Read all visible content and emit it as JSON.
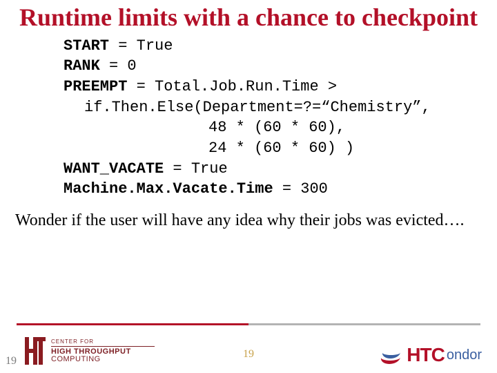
{
  "title": "Runtime limits with a chance to checkpoint",
  "config": {
    "start_k": "START",
    "start_v": " = True",
    "rank_k": "RANK",
    "rank_v": " = 0",
    "preempt_k": "PREEMPT",
    "preempt_v": " = Total.Job.Run.Time >",
    "ifthen": "if.Then.Else(Department=?=“Chemistry”,",
    "line48": "48 * (60 * 60),",
    "line24": "24 * (60 * 60) )",
    "wv_k": "WANT_VACATE",
    "wv_v": " = True",
    "mmvt_k": "Machine.Max.Vacate.Time",
    "mmvt_v": " = 300"
  },
  "remark": "Wonder if the user will have any idea why their jobs was evicted….",
  "page_center": "19",
  "page_left": "19",
  "logo_left": {
    "l1": "CENTER FOR",
    "l2": "HIGH THROUGHPUT",
    "l3": "COMPUTING"
  },
  "logo_right": {
    "ht": "HTC",
    "ondor": "ondor"
  }
}
